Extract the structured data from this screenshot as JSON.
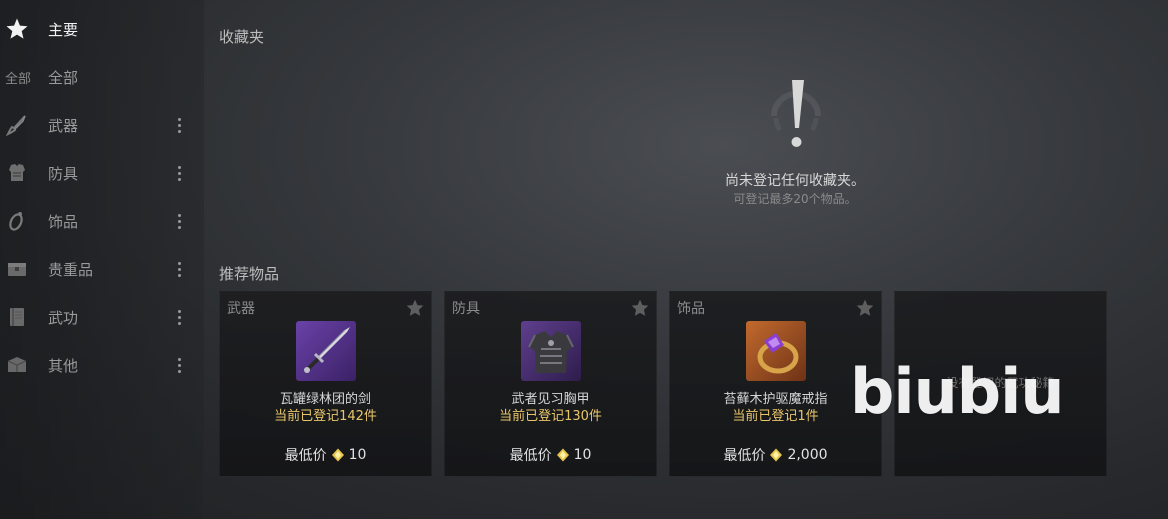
{
  "sidebar": {
    "items": [
      {
        "label": "主要",
        "icon": "star-icon",
        "active": true,
        "menu": false
      },
      {
        "label": "全部",
        "icon_text": "全部",
        "menu": false
      },
      {
        "label": "武器",
        "icon": "sword-icon",
        "menu": true
      },
      {
        "label": "防具",
        "icon": "armor-icon",
        "menu": true
      },
      {
        "label": "饰品",
        "icon": "ring-icon",
        "menu": true
      },
      {
        "label": "贵重品",
        "icon": "chest-icon",
        "menu": true
      },
      {
        "label": "武功",
        "icon": "book-icon",
        "menu": true
      },
      {
        "label": "其他",
        "icon": "box-icon",
        "menu": true
      }
    ]
  },
  "favorites": {
    "title": "收藏夹",
    "empty_title": "尚未登记任何收藏夹。",
    "empty_hint": "可登记最多20个物品。",
    "icon": "exclamation-icon"
  },
  "recommended": {
    "title": "推荐物品",
    "price_label": "最低价",
    "items": [
      {
        "category": "武器",
        "name": "瓦罐绿林团的剑",
        "count": "当前已登记142件",
        "price": "10",
        "image": "sword-item-icon"
      },
      {
        "category": "防具",
        "name": "武者见习胸甲",
        "count": "当前已登记130件",
        "price": "10",
        "image": "chest-armor-item-icon"
      },
      {
        "category": "饰品",
        "name": "苔藓木护驱魔戒指",
        "count": "当前已登记1件",
        "price": "2,000",
        "image": "ring-item-icon"
      }
    ],
    "empty_card_text": "没有登记的武功秘籍"
  },
  "watermark": "biubiu",
  "colors": {
    "count_text": "#e9c66a",
    "gem": "#e8c54a",
    "accent_purple": "#7a4bb8"
  }
}
